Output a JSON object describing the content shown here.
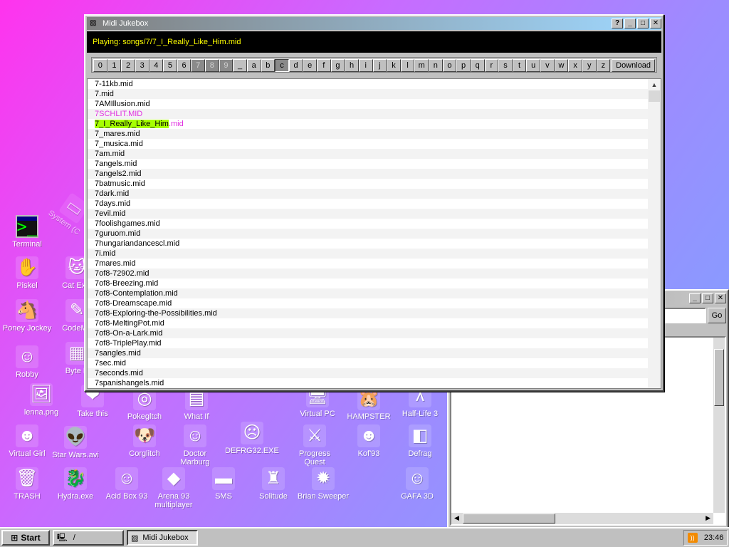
{
  "desktop_icons": [
    {
      "label": "Terminal",
      "icon": "terminal-icon",
      "glyph": ">_"
    },
    {
      "label": "Piskel",
      "icon": "piskel-icon",
      "glyph": "✋"
    },
    {
      "label": "Cat Expl",
      "icon": "cat-explorer-icon",
      "glyph": "🐱"
    },
    {
      "label": "Poney Jockey",
      "icon": "pony-icon",
      "glyph": "🐴"
    },
    {
      "label": "CodeMir",
      "icon": "codemirror-icon",
      "glyph": "✎"
    },
    {
      "label": "Robby",
      "icon": "robby-icon",
      "glyph": "☺"
    },
    {
      "label": "Byte B",
      "icon": "byte-beat-icon",
      "glyph": "▦"
    },
    {
      "label": "lenna.png",
      "icon": "image-file-icon",
      "glyph": "🖼"
    },
    {
      "label": "Take this",
      "icon": "take-this-icon",
      "glyph": "❤"
    },
    {
      "label": "Pokegltch",
      "icon": "pokeglitch-icon",
      "glyph": "◎"
    },
    {
      "label": "What If",
      "icon": "what-if-icon",
      "glyph": "▤"
    },
    {
      "label": "Virtual PC",
      "icon": "virtual-pc-icon",
      "glyph": "🖥"
    },
    {
      "label": "HAMPSTER",
      "icon": "hampster-icon",
      "glyph": "🐹"
    },
    {
      "label": "Half-Life 3",
      "icon": "half-life-icon",
      "glyph": "λ"
    },
    {
      "label": "Virtual Girl",
      "icon": "virtual-girl-icon",
      "glyph": "☻"
    },
    {
      "label": "Star Wars.avi",
      "icon": "yoda-icon",
      "glyph": "👽"
    },
    {
      "label": "Corglitch",
      "icon": "corgi-icon",
      "glyph": "🐶"
    },
    {
      "label": "Doctor Marburg",
      "icon": "doctor-icon",
      "glyph": "☺"
    },
    {
      "label": "DEFRG32.EXE",
      "icon": "defrag-exe-icon",
      "glyph": "☹"
    },
    {
      "label": "Progress Quest",
      "icon": "progress-quest-icon",
      "glyph": "⚔"
    },
    {
      "label": "Kof'93",
      "icon": "kof-icon",
      "glyph": "☻"
    },
    {
      "label": "Defrag",
      "icon": "defrag-icon",
      "glyph": "◧"
    },
    {
      "label": "TRASH",
      "icon": "trash-icon",
      "glyph": "🗑"
    },
    {
      "label": "Hydra.exe",
      "icon": "hydra-icon",
      "glyph": "🐉"
    },
    {
      "label": "Acid Box 93",
      "icon": "acid-smiley-icon",
      "glyph": "☺"
    },
    {
      "label": "Arena 93 multiplayer",
      "icon": "arena-cube-icon",
      "glyph": "◆"
    },
    {
      "label": "SMS",
      "icon": "sms-icon",
      "glyph": "▬"
    },
    {
      "label": "Solitude",
      "icon": "solitude-icon",
      "glyph": "♜"
    },
    {
      "label": "Brian Sweeper",
      "icon": "mine-icon",
      "glyph": "✹"
    },
    {
      "label": "GAFA 3D",
      "icon": "gafa-icon",
      "glyph": "☺"
    },
    {
      "label": "System (C",
      "icon": "system-drive-icon",
      "glyph": "▭"
    }
  ],
  "jukebox": {
    "title": "Midi Jukebox",
    "now_playing": "Playing: songs/7/7_I_Really_Like_Him.mid",
    "buttons": {
      "help": "?",
      "minimize": "_",
      "maximize": "□",
      "close": "✕"
    },
    "letters": [
      "0",
      "1",
      "2",
      "3",
      "4",
      "5",
      "6",
      "7",
      "8",
      "9",
      "_",
      "a",
      "b",
      "c",
      "d",
      "e",
      "f",
      "g",
      "h",
      "i",
      "j",
      "k",
      "l",
      "m",
      "n",
      "o",
      "p",
      "q",
      "r",
      "s",
      "t",
      "u",
      "v",
      "w",
      "x",
      "y",
      "z"
    ],
    "disabled_letters": [
      "7",
      "8",
      "9"
    ],
    "selected_letter": "c",
    "download_label": "Download",
    "files": [
      "7-11kb.mid",
      "7.mid",
      "7AMIllusion.mid",
      "7SCHLIT.MID",
      "7_I_Really_Like_Him.mid",
      "7_mares.mid",
      "7_musica.mid",
      "7am.mid",
      "7angels.mid",
      "7angels2.mid",
      "7batmusic.mid",
      "7dark.mid",
      "7days.mid",
      "7evil.mid",
      "7foolishgames.mid",
      "7guruom.mid",
      "7hungariandancescl.mid",
      "7i.mid",
      "7mares.mid",
      "7of8-72902.mid",
      "7of8-Breezing.mid",
      "7of8-Contemplation.mid",
      "7of8-Dreamscape.mid",
      "7of8-Exploring-the-Possibilities.mid",
      "7of8-MeltingPot.mid",
      "7of8-On-a-Lark.mid",
      "7of8-TriplePlay.mid",
      "7sangles.mid",
      "7sec.mid",
      "7seconds.mid",
      "7spanishangels.mid"
    ],
    "visited_file": "7SCHLIT.MID",
    "playing_file": "7_I_Really_Like_Him.mid",
    "playing_highlight": "7_I_Really_Like_Him",
    "playing_rest": ".mid"
  },
  "browser": {
    "buttons": {
      "minimize": "_",
      "maximize": "□",
      "close": "✕"
    },
    "go_label": "Go",
    "address_value": ""
  },
  "taskbar": {
    "start_label": "Start",
    "tasks": [
      {
        "label": "/",
        "icon": "computer-icon",
        "active": false
      },
      {
        "label": "Midi Jukebox",
        "icon": "jukebox-icon",
        "active": true
      }
    ],
    "clock": "23:46",
    "tray_icon": "rss-icon"
  },
  "colors": {
    "visited": "#e030e0",
    "playing_highlight": "#a6ff00",
    "now_playing_text": "#ffff00",
    "now_playing_bg": "#000000"
  }
}
